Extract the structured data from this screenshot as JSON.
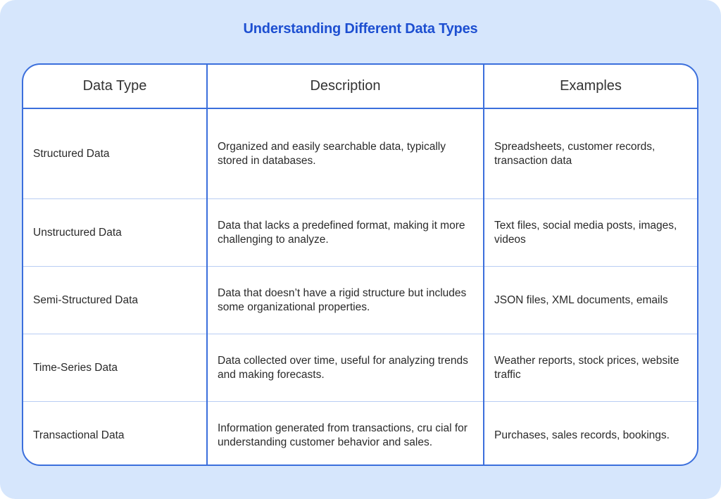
{
  "title": "Understanding Different Data Types",
  "colors": {
    "background": "#d6e6fc",
    "accent": "#1d4fd1",
    "border": "#3b6fdc"
  },
  "table": {
    "headers": [
      "Data Type",
      "Description",
      "Examples"
    ],
    "rows": [
      {
        "type": "Structured Data",
        "description": "Organized and easily searchable data, typically stored in databases.",
        "examples": "Spreadsheets, customer records, transaction data"
      },
      {
        "type": "Unstructured Data",
        "description": "Data that lacks a predefined format, making it more challenging to analyze.",
        "examples": "Text files, social media posts, images, videos"
      },
      {
        "type": "Semi-Structured Data",
        "description": "Data that doesn’t have a rigid structure but includes some organizational properties.",
        "examples": "JSON files, XML documents, emails"
      },
      {
        "type": "Time-Series Data",
        "description": "Data collected over time, useful for analyzing trends and making forecasts.",
        "examples": "Weather reports, stock prices, website traffic"
      },
      {
        "type": "Transactional Data",
        "description": "Information generated from transactions, cru cial for understanding customer behavior and sales.",
        "examples": "Purchases, sales records, bookings."
      }
    ]
  }
}
